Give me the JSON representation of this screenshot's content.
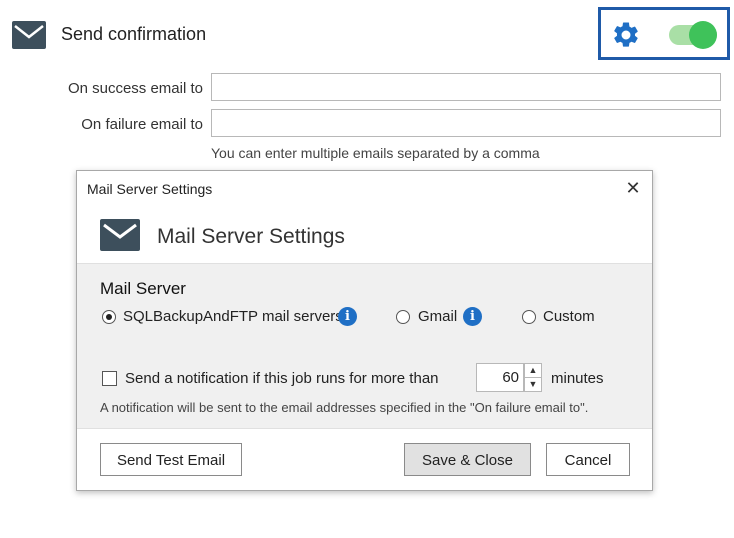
{
  "section": {
    "title": "Send confirmation",
    "toggle_on": true,
    "accent_green": "#3fc25a",
    "gear_color": "#1f6fc5"
  },
  "fields": {
    "success_label": "On success email to",
    "success_value": "",
    "failure_label": "On failure email to",
    "failure_value": "",
    "hint": "You can enter multiple emails separated by a comma"
  },
  "dialog": {
    "window_title": "Mail Server Settings",
    "close_glyph": "✕",
    "heading": "Mail Server Settings",
    "group_title": "Mail Server",
    "radios": [
      {
        "label": "SQLBackupAndFTP mail servers",
        "checked": true,
        "has_info": true
      },
      {
        "label": "Gmail",
        "checked": false,
        "has_info": true
      },
      {
        "label": "Custom",
        "checked": false,
        "has_info": false
      }
    ],
    "info_glyph": "i",
    "notify_checkbox_label": "Send a notification if this job runs for more than",
    "notify_checked": false,
    "minutes_value": "60",
    "minutes_unit": "minutes",
    "spin_up": "▲",
    "spin_down": "▼",
    "note": "A notification will be sent to the email addresses specified in the \"On failure email to\".",
    "buttons": {
      "test": "Send Test Email",
      "save": "Save & Close",
      "cancel": "Cancel"
    }
  }
}
